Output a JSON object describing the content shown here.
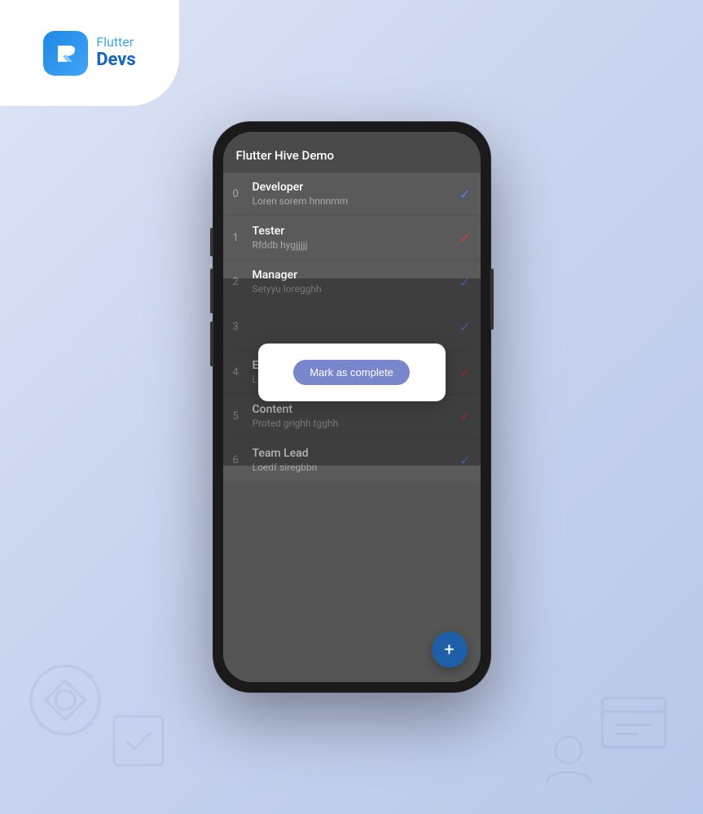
{
  "logo": {
    "flutter_label": "Flutter",
    "devs_label": "Devs",
    "icon_letter": "p"
  },
  "app": {
    "title": "Flutter Hive Demo"
  },
  "list_items": [
    {
      "index": "0",
      "title": "Developer",
      "subtitle": "Loren sorem hnnnmm",
      "check_type": "blue"
    },
    {
      "index": "1",
      "title": "Tester",
      "subtitle": "Rfddb hygjjjjj",
      "check_type": "red"
    },
    {
      "index": "2",
      "title": "Manager",
      "subtitle": "Setyyu loregghh",
      "check_type": "blue"
    },
    {
      "index": "3",
      "title": "",
      "subtitle": "",
      "check_type": "blue"
    },
    {
      "index": "4",
      "title": "Editor",
      "subtitle": "Lore tyhhjkk",
      "check_type": "red"
    },
    {
      "index": "5",
      "title": "Content",
      "subtitle": "Proted grighh tgghh",
      "check_type": "red"
    },
    {
      "index": "6",
      "title": "Team Lead",
      "subtitle": "Loedf siregbbn",
      "check_type": "blue"
    }
  ],
  "popup": {
    "button_label": "Mark as complete"
  },
  "fab": {
    "label": "+"
  }
}
